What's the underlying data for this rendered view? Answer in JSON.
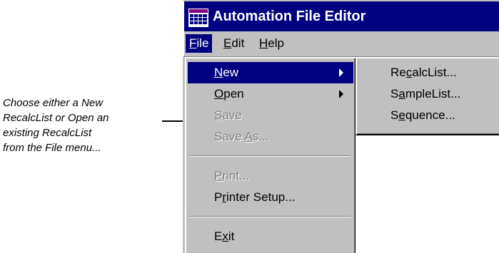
{
  "callout": {
    "lines": [
      "Choose either a New",
      "RecalcList or Open an",
      "existing RecalcList",
      "from the File menu..."
    ]
  },
  "window": {
    "title": "Automation File Editor",
    "icon": "spreadsheet-grid-icon"
  },
  "menubar": {
    "file": {
      "mnemonic": "F",
      "rest": "ile"
    },
    "edit": {
      "mnemonic": "E",
      "rest": "dit"
    },
    "help": {
      "mnemonic": "H",
      "rest": "elp"
    }
  },
  "file_menu": {
    "new": {
      "mnemonic": "N",
      "rest": "ew"
    },
    "open": {
      "mnemonic": "O",
      "rest": "pen"
    },
    "save": {
      "mnemonic": "S",
      "rest": "ave"
    },
    "save_as": {
      "pre": "Save ",
      "mnemonic": "A",
      "rest": "s..."
    },
    "print": {
      "mnemonic": "P",
      "rest": "rint..."
    },
    "printer_setup": {
      "pre": "P",
      "mnemonic": "r",
      "rest": "inter Setup..."
    },
    "exit": {
      "pre": "E",
      "mnemonic": "x",
      "rest": "it"
    }
  },
  "new_submenu": {
    "recalclist": {
      "pre": "Re",
      "mnemonic": "c",
      "rest": "alcList..."
    },
    "samplelist": {
      "pre": "S",
      "mnemonic": "a",
      "rest": "mpleList..."
    },
    "sequence": {
      "pre": "S",
      "mnemonic": "e",
      "rest": "quence..."
    }
  },
  "colors": {
    "title_bar": "#000080",
    "menu_bg": "#c0c0c0",
    "highlight": "#000080",
    "disabled_text": "#808080"
  }
}
